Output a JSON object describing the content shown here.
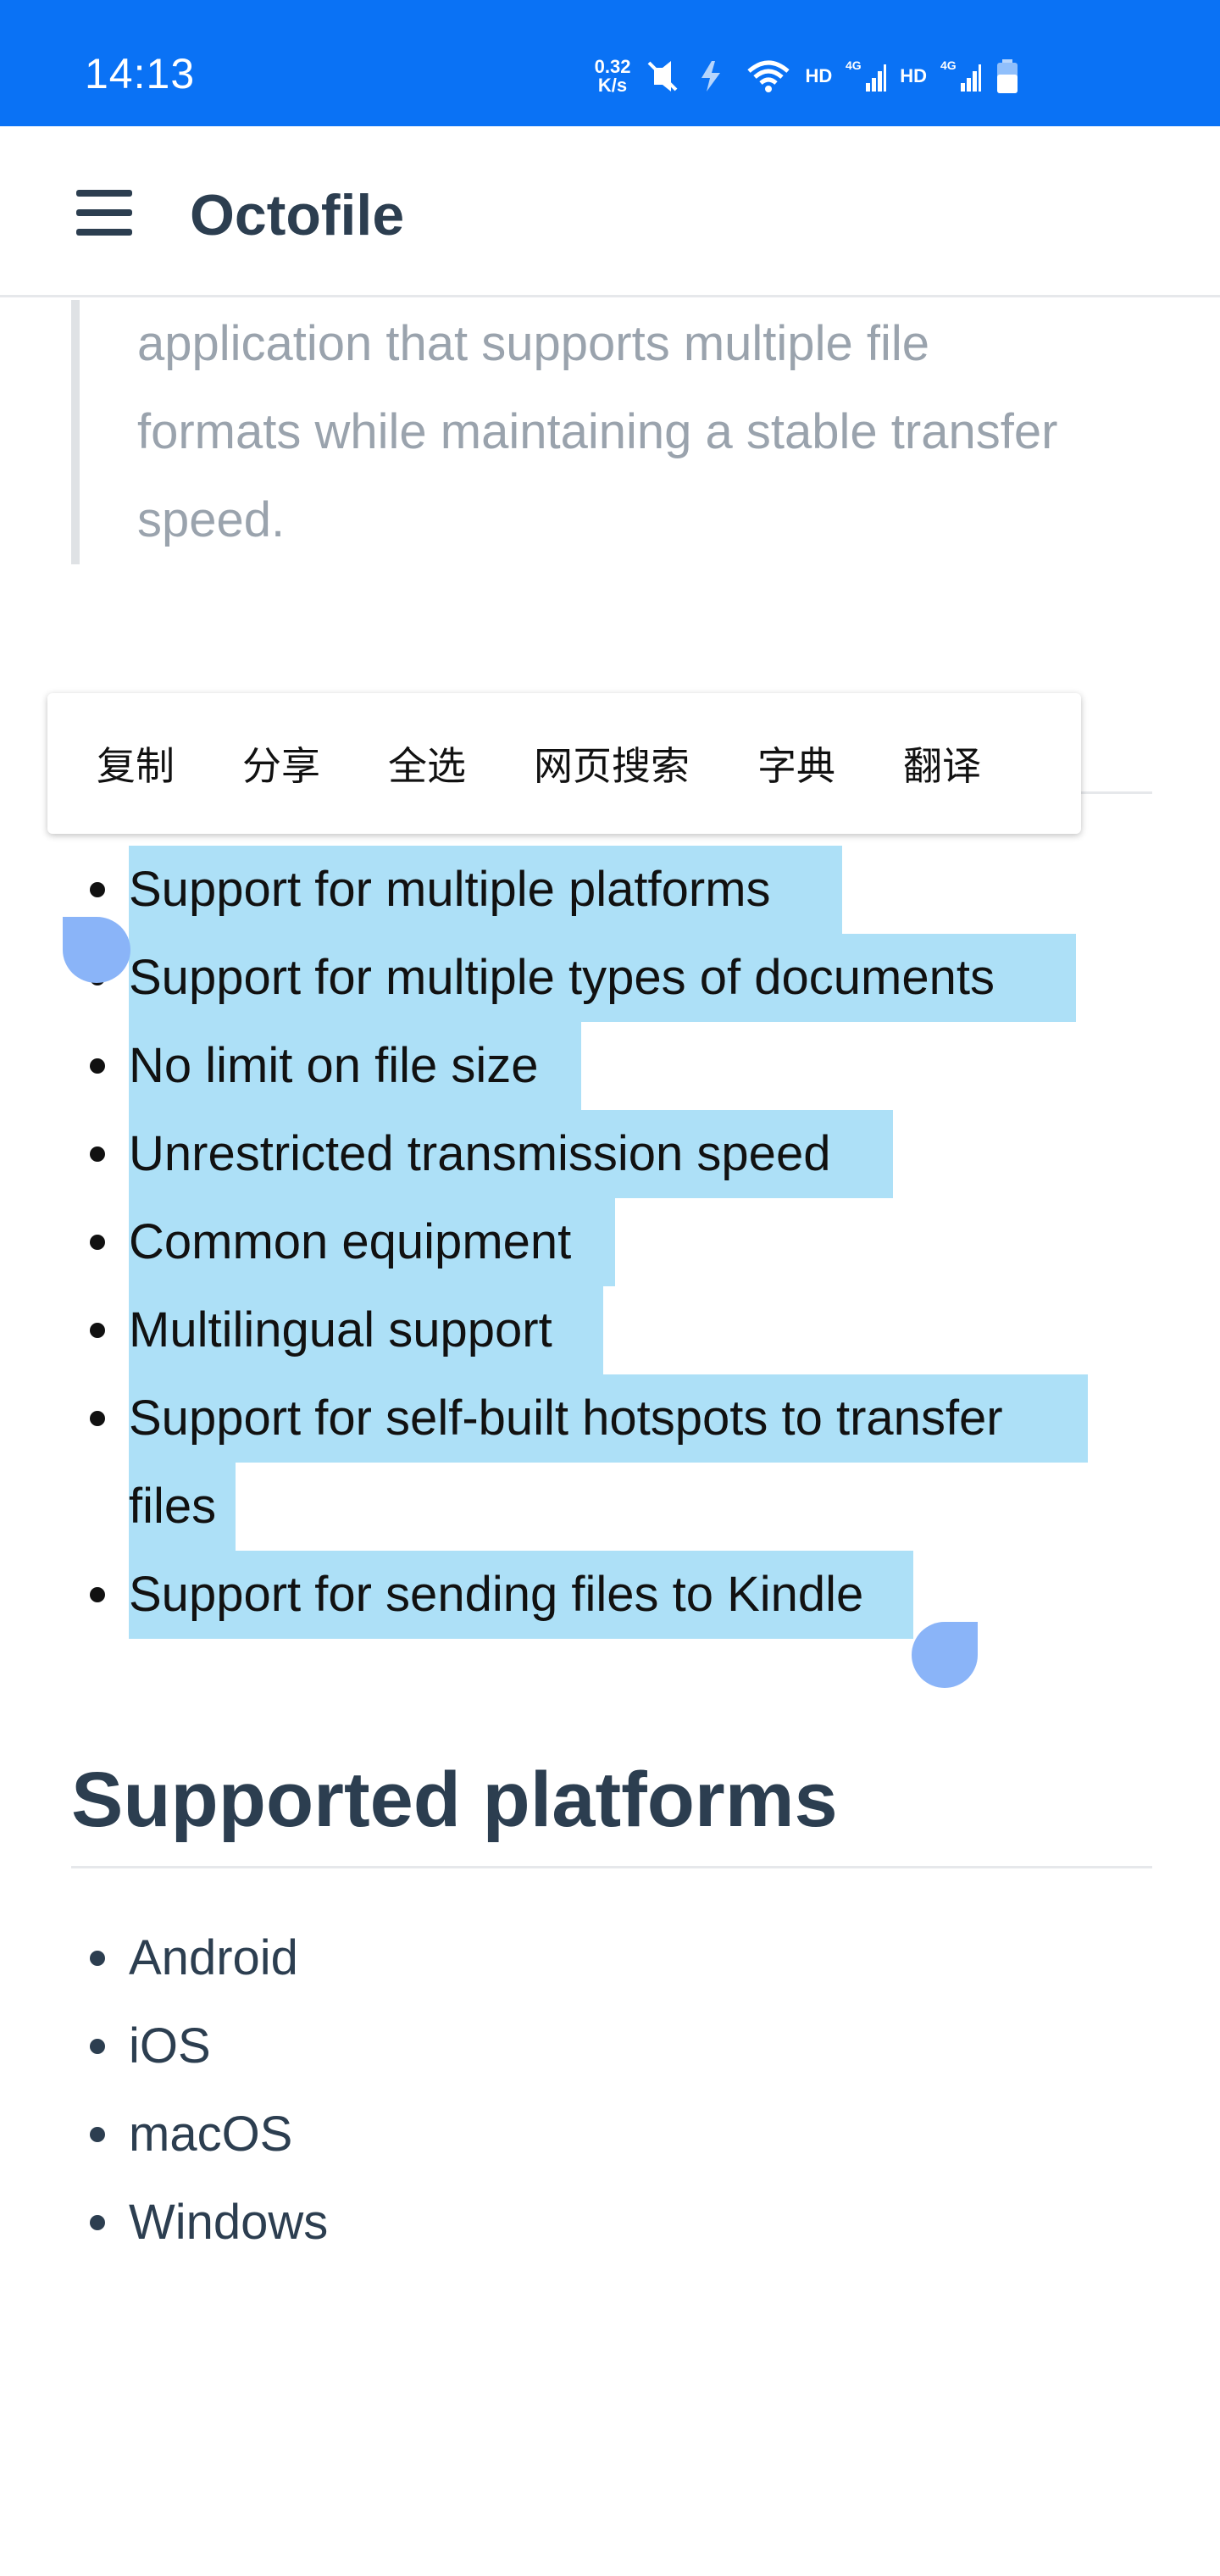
{
  "status_bar": {
    "time": "14:13",
    "net_speed_value": "0.32",
    "net_speed_unit": "K/s",
    "hd_label_1": "HD",
    "hd_label_2": "HD",
    "icons": [
      "mute-vibrate-icon",
      "data-saver-icon",
      "wifi-icon",
      "signal-icon",
      "signal-icon",
      "battery-icon"
    ]
  },
  "app_bar": {
    "title": "Octofile",
    "menu_icon": "hamburger-menu-icon"
  },
  "blockquote": {
    "lines": [
      "application that supports multiple file",
      "formats while maintaining a stable transfer",
      "speed."
    ]
  },
  "context_menu": {
    "items": [
      "复制",
      "分享",
      "全选",
      "网页搜索",
      "字典",
      "翻译"
    ]
  },
  "features": {
    "items": [
      "Support for multiple platforms",
      "Support for multiple types of documents",
      "No limit on file size",
      "Unrestricted transmission speed",
      "Common equipment",
      "Multilingual support",
      "Support for self-built hotspots to transfer",
      "files",
      "Support for sending files to Kindle"
    ],
    "selection_color": "#ade0f7",
    "handle_color": "#8ab4f8"
  },
  "platforms": {
    "heading": "Supported platforms",
    "items": [
      "Android",
      "iOS",
      "macOS",
      "Windows"
    ]
  },
  "colors": {
    "status_bar": "#0a72f5",
    "text": "#2c3e50",
    "quote_text": "#9aa3ad"
  }
}
